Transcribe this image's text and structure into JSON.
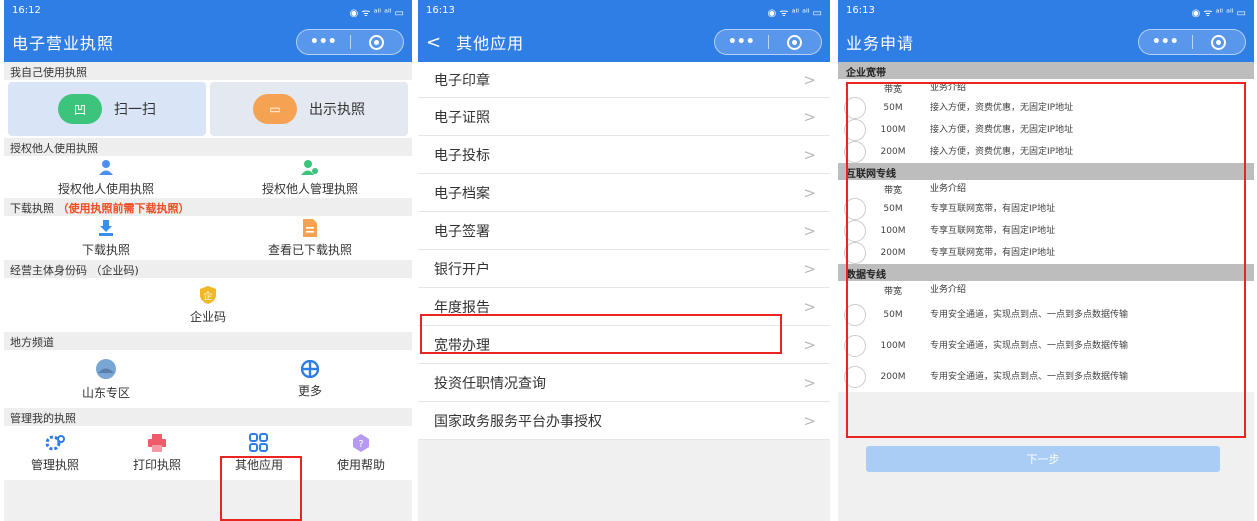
{
  "screens": {
    "s1": {
      "time": "16:12",
      "status_icons": "◉ ᯤ ᵃˡˡ ᵃˡˡ ▭",
      "title": "电子营业执照",
      "sections": {
        "self_use": "我自己使用执照",
        "scan_label": "扫一扫",
        "scan_pill": "凹",
        "show_label": "出示执照",
        "show_pill": "▭",
        "authorize": "授权他人使用执照",
        "auth_use": "授权他人使用执照",
        "auth_manage": "授权他人管理执照",
        "download": "下载执照",
        "download_note": "（使用执照前需下载执照）",
        "download_item": "下载执照",
        "view_downloaded": "查看已下载执照",
        "entity_code": "经营主体身份码 （企业码)",
        "entity_code_item": "企业码",
        "local": "地方频道",
        "shandong": "山东专区",
        "more": "更多",
        "manage_my": "管理我的执照",
        "manage": "管理执照",
        "print": "打印执照",
        "other_apps": "其他应用",
        "help": "使用帮助"
      }
    },
    "s2": {
      "time": "16:13",
      "status_icons": "◉ ᯤ ᵃˡˡ ᵃˡˡ ▭",
      "back": "<",
      "title": "其他应用",
      "items": [
        "电子印章",
        "电子证照",
        "电子投标",
        "电子档案",
        "电子签署",
        "银行开户",
        "年度报告",
        "宽带办理",
        "投资任职情况查询",
        "国家政务服务平台办事授权"
      ],
      "chevron": ">"
    },
    "s3": {
      "time": "16:13",
      "status_icons": "◉ ᯤ ᵃˡˡ ᵃˡˡ ▭",
      "title": "业务申请",
      "col_bandwidth": "带宽",
      "col_intro": "业务介绍",
      "groups": [
        {
          "name": "企业宽带",
          "rows": [
            {
              "bw": "50M",
              "desc": "接入方便，资费优惠，无固定IP地址"
            },
            {
              "bw": "100M",
              "desc": "接入方便，资费优惠，无固定IP地址"
            },
            {
              "bw": "200M",
              "desc": "接入方便，资费优惠，无固定IP地址"
            }
          ]
        },
        {
          "name": "互联网专线",
          "rows": [
            {
              "bw": "50M",
              "desc": "专享互联网宽带，有固定IP地址"
            },
            {
              "bw": "100M",
              "desc": "专享互联网宽带，有固定IP地址"
            },
            {
              "bw": "200M",
              "desc": "专享互联网宽带，有固定IP地址"
            }
          ]
        },
        {
          "name": "数据专线",
          "rows": [
            {
              "bw": "50M",
              "desc": "专用安全通道，实现点到点、一点到多点数据传输"
            },
            {
              "bw": "100M",
              "desc": "专用安全通道，实现点到点、一点到多点数据传输"
            },
            {
              "bw": "200M",
              "desc": "专用安全通道，实现点到点、一点到多点数据传输"
            }
          ]
        }
      ],
      "next_button": "下一步"
    }
  },
  "colors": {
    "brand_blue": "#2f7ee6",
    "highlight_red": "#e8251f",
    "note_red": "#f04b23"
  }
}
